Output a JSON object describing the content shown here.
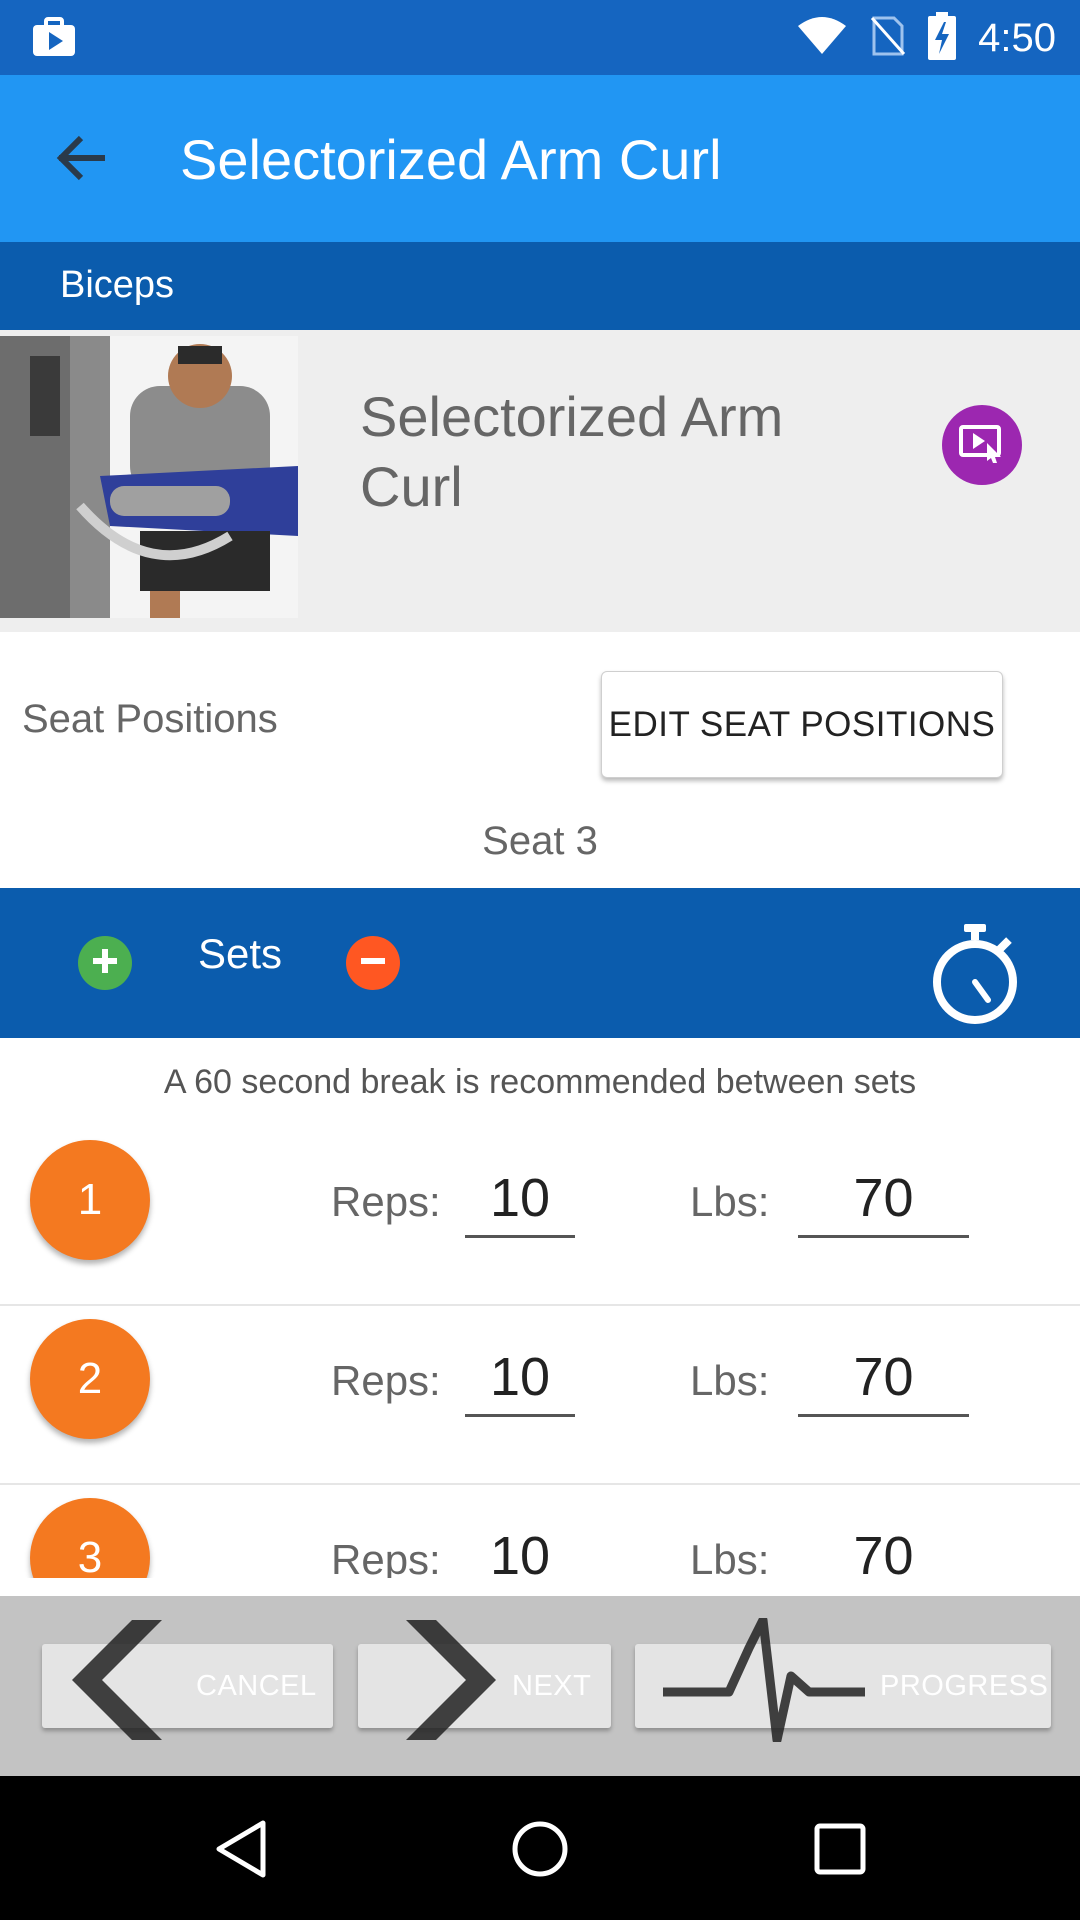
{
  "status_bar": {
    "time": "4:50",
    "icons": [
      "briefcase-play-icon",
      "wifi-icon",
      "no-sim-icon",
      "battery-charging-icon"
    ]
  },
  "app_bar": {
    "title": "Selectorized Arm Curl",
    "back_icon": "arrow-left-icon"
  },
  "category": {
    "label": "Biceps"
  },
  "exercise": {
    "name": "Selectorized Arm Curl",
    "video_icon": "video-tap-icon",
    "video_color": "#9c27b0"
  },
  "seat": {
    "label": "Seat Positions",
    "edit_button": "EDIT SEAT POSITIONS",
    "value": "Seat 3"
  },
  "sets_bar": {
    "label": "Sets",
    "add_icon": "plus-circle-icon",
    "remove_icon": "minus-circle-icon",
    "timer_icon": "stopwatch-icon",
    "add_color": "#4caf50",
    "remove_color": "#ff5722"
  },
  "break_note": "A 60 second break is recommended between sets",
  "sets": [
    {
      "number": "1",
      "reps_label": "Reps:",
      "reps": "10",
      "lbs_label": "Lbs:",
      "lbs": "70"
    },
    {
      "number": "2",
      "reps_label": "Reps:",
      "reps": "10",
      "lbs_label": "Lbs:",
      "lbs": "70"
    },
    {
      "number": "3",
      "reps_label": "Reps:",
      "reps": "10",
      "lbs_label": "Lbs:",
      "lbs": "70"
    }
  ],
  "bottom_actions": {
    "cancel": "CANCEL",
    "next": "NEXT",
    "progress": "PROGRESS"
  },
  "nav_bar": {
    "back": "nav-back-icon",
    "home": "nav-home-icon",
    "recents": "nav-recents-icon"
  },
  "colors": {
    "status_bar": "#1565c0",
    "app_bar": "#2196f3",
    "section_bar": "#0b5cad",
    "set_badge": "#f47920"
  }
}
